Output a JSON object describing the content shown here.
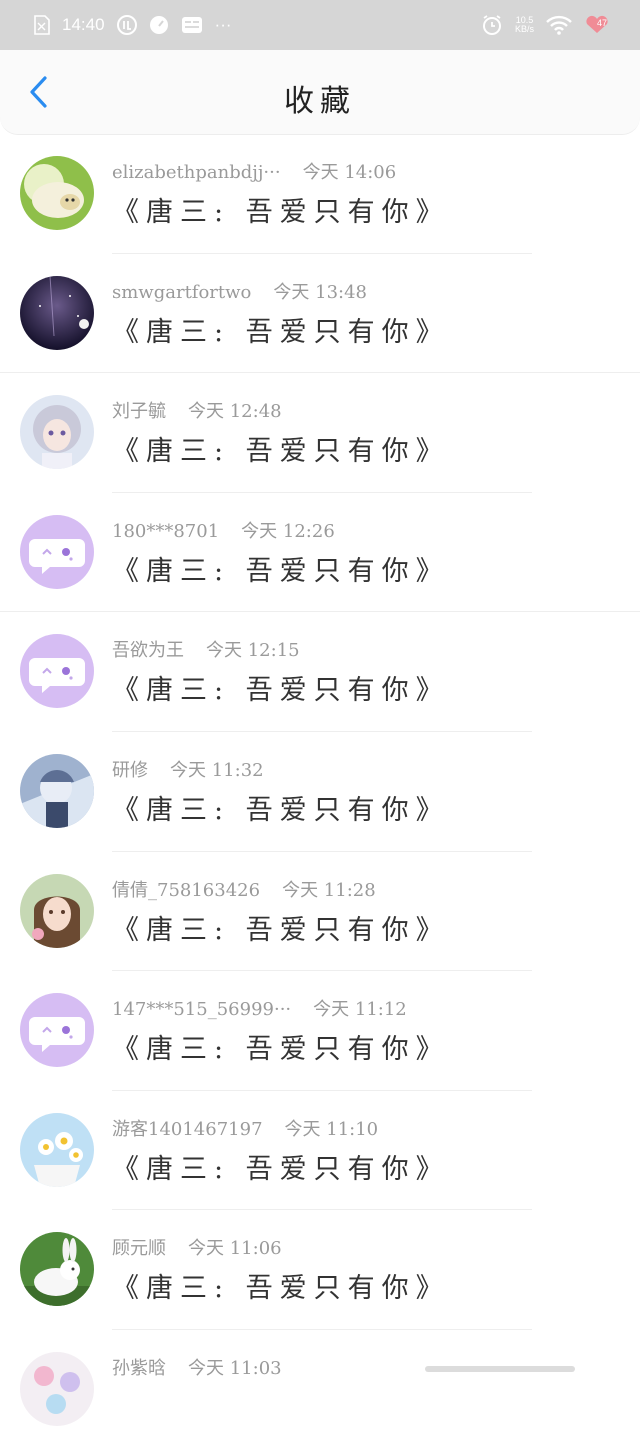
{
  "status_bar": {
    "time": "14:40",
    "more": "···",
    "net_speed_value": "10.5",
    "net_speed_unit": "KB/s",
    "battery": "47"
  },
  "header": {
    "title": "收藏"
  },
  "items": [
    {
      "name": "elizabethpanbdjj···",
      "time": "今天 14:06",
      "message": "《唐三: 吾爱只有你》",
      "avatar": "lamb-photo-avatar"
    },
    {
      "name": "smwgartfortwo",
      "time": "今天 13:48",
      "message": "《唐三: 吾爱只有你》",
      "avatar": "night-sky-avatar"
    },
    {
      "name": "刘子毓",
      "time": "今天 12:48",
      "message": "《唐三: 吾爱只有你》",
      "avatar": "anime-girl-avatar"
    },
    {
      "name": "180***8701",
      "time": "今天 12:26",
      "message": "《唐三: 吾爱只有你》",
      "avatar": "default-chat-avatar"
    },
    {
      "name": "吾欲为王",
      "time": "今天 12:15",
      "message": "《唐三: 吾爱只有你》",
      "avatar": "default-chat-avatar"
    },
    {
      "name": "研修",
      "time": "今天 11:32",
      "message": "《唐三: 吾爱只有你》",
      "avatar": "anime-boy-avatar"
    },
    {
      "name": "倩倩_758163426",
      "time": "今天 11:28",
      "message": "《唐三: 吾爱只有你》",
      "avatar": "portrait-girl-avatar"
    },
    {
      "name": "147***515_56999···",
      "time": "今天 11:12",
      "message": "《唐三: 吾爱只有你》",
      "avatar": "default-chat-avatar"
    },
    {
      "name": "游客1401467197",
      "time": "今天 11:10",
      "message": "《唐三: 吾爱只有你》",
      "avatar": "daisy-flowers-avatar"
    },
    {
      "name": "顾元顺",
      "time": "今天 11:06",
      "message": "《唐三: 吾爱只有你》",
      "avatar": "white-rabbit-avatar"
    },
    {
      "name": "孙紫晗",
      "time": "今天 11:03",
      "message": "",
      "avatar": "flowers-avatar"
    }
  ],
  "colors": {
    "accent": "#2a8cf0",
    "default_avatar": "#d6bdf3",
    "status_bar": "#d6d6d6"
  }
}
